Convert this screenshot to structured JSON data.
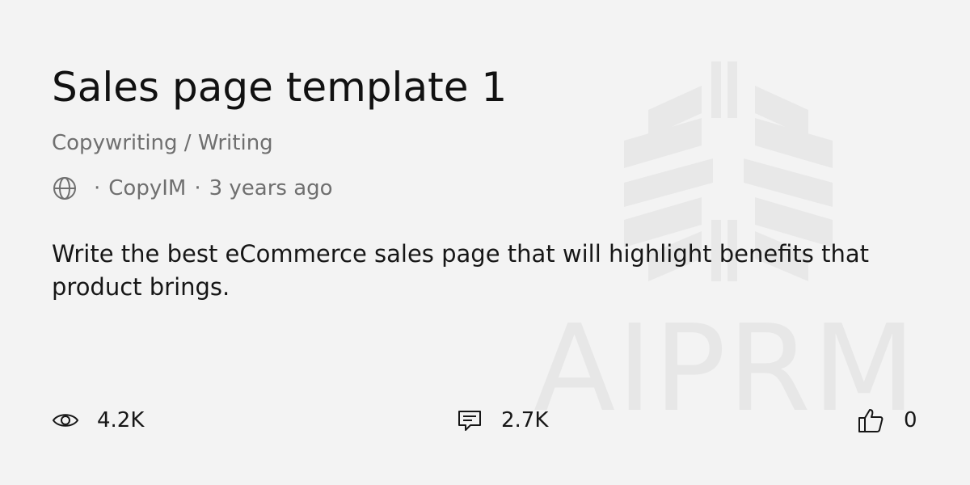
{
  "card": {
    "title": "Sales page template 1",
    "category": "Copywriting / Writing",
    "meta": {
      "visibility_icon": "globe-icon",
      "separator": "·",
      "author": "CopyIM",
      "time_ago": "3 years ago"
    },
    "description": "Write the best eCommerce sales page that will highlight benefits that product brings.",
    "stats": {
      "views": {
        "icon": "eye-icon",
        "value": "4.2K"
      },
      "comments": {
        "icon": "comment-icon",
        "value": "2.7K"
      },
      "likes": {
        "icon": "thumbs-up-icon",
        "value": "0"
      }
    }
  },
  "watermark": {
    "logo_icon": "aiprm-logo-icon",
    "text": "AIPRM"
  },
  "colors": {
    "background": "#f3f3f3",
    "title": "#111111",
    "muted": "#6f6f6f",
    "watermark": "#e7e7e7"
  }
}
